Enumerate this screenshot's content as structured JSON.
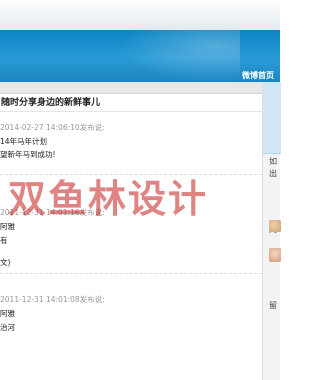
{
  "header": {
    "weibo_home": "微博首页"
  },
  "main": {
    "slogan": "随时分享身边的新鲜事儿"
  },
  "posts": [
    {
      "meta": "2014-02-27 14:06:10发布说:",
      "title": "14年马年计划",
      "lines": [
        "望新年马到成功!"
      ]
    },
    {
      "meta": "2011-12-31 14:01:16发布说:",
      "title": "阿雅",
      "lines": [
        "有",
        "文)"
      ]
    },
    {
      "meta": "2011-12-31 14:01:08发布说:",
      "title": "阿雅",
      "lines": [
        "治河"
      ]
    }
  ],
  "sidebar": {
    "text1": "如",
    "text2": "出",
    "section1": "网",
    "section2": "留"
  },
  "watermark": "双鱼林设计",
  "colors": {
    "header": "#1a8fd0",
    "watermark": "#c41e1e"
  }
}
